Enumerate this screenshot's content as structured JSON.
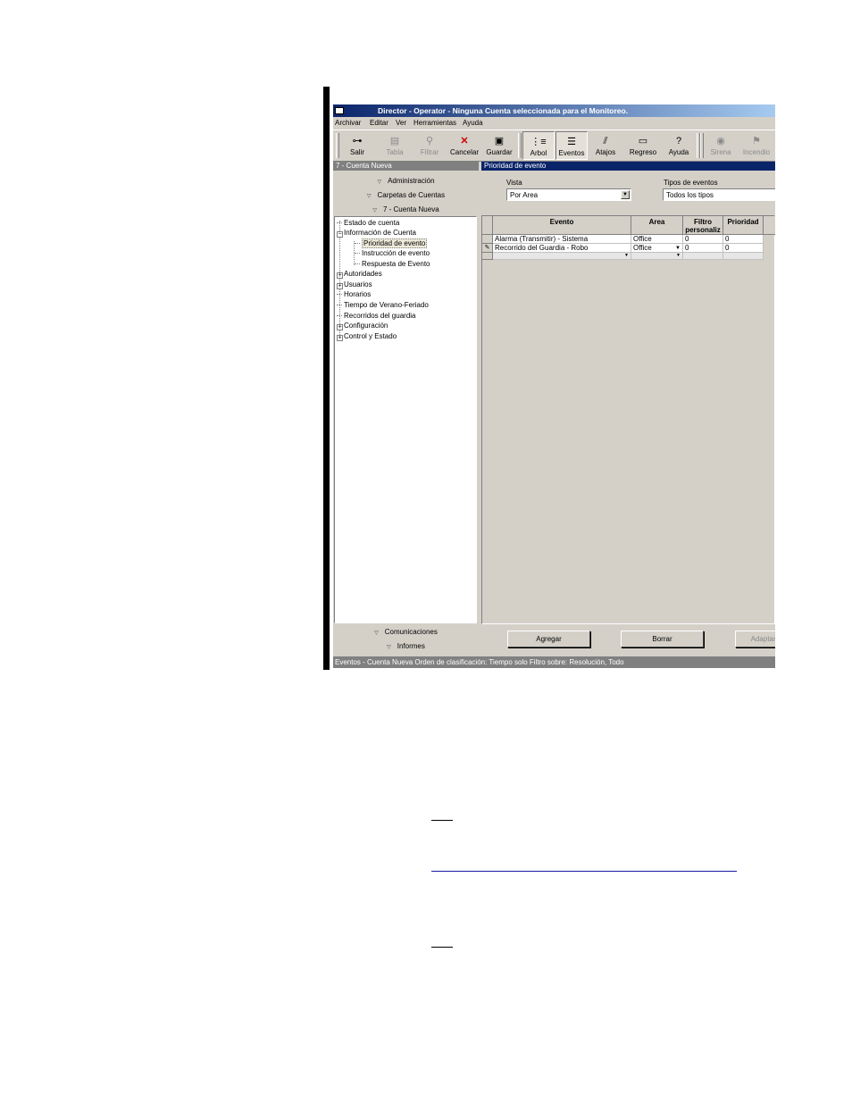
{
  "window": {
    "title": "Director - Operator - Ninguna Cuenta seleccionada para el Monitoreo."
  },
  "menu": [
    "Archivar",
    "Editar",
    "Ver",
    "Herramientas",
    "Ayuda"
  ],
  "toolbar": [
    {
      "label": "Salir",
      "icon": "key-icon",
      "glyph": "⊶",
      "state": "normal"
    },
    {
      "label": "Tabla",
      "icon": "table-icon",
      "glyph": "▤",
      "state": "disabled"
    },
    {
      "label": "Filtrar",
      "icon": "filter-icon",
      "glyph": "⚲",
      "state": "disabled"
    },
    {
      "label": "Cancelar",
      "icon": "cancel-icon",
      "glyph": "✕",
      "state": "normal"
    },
    {
      "label": "Guardar",
      "icon": "save-icon",
      "glyph": "▣",
      "state": "normal"
    },
    {
      "label": "Arbol",
      "icon": "tree-icon",
      "glyph": "⋮≡",
      "state": "pressed"
    },
    {
      "label": "Eventos",
      "icon": "events-icon",
      "glyph": "☰",
      "state": "pressed"
    },
    {
      "label": "Atajos",
      "icon": "shortcuts-icon",
      "glyph": "⫽",
      "state": "normal"
    },
    {
      "label": "Regreso",
      "icon": "return-icon",
      "glyph": "▭",
      "state": "normal"
    },
    {
      "label": "Ayuda",
      "icon": "help-icon",
      "glyph": "?",
      "state": "normal"
    },
    {
      "label": "Sirena",
      "icon": "siren-icon",
      "glyph": "◉",
      "state": "disabled"
    },
    {
      "label": "Incendio",
      "icon": "fire-icon",
      "glyph": "⚑",
      "state": "disabled"
    }
  ],
  "left_panel": {
    "header": "7 - Cuenta Nueva",
    "nav_top": [
      "Administración",
      "Carpetas de Cuentas",
      "7 - Cuenta Nueva"
    ],
    "tree": [
      {
        "label": "Estado de cuenta",
        "level": 0,
        "expander": ""
      },
      {
        "label": "Información de Cuenta",
        "level": 0,
        "expander": "−"
      },
      {
        "label": "Prioridad de evento",
        "level": 1,
        "expander": "",
        "selected": true
      },
      {
        "label": "Instrucción de evento",
        "level": 1,
        "expander": ""
      },
      {
        "label": "Respuesta de Evento",
        "level": 1,
        "expander": ""
      },
      {
        "label": "Autoridades",
        "level": 0,
        "expander": "+"
      },
      {
        "label": "Usuarios",
        "level": 0,
        "expander": "+"
      },
      {
        "label": "Horarios",
        "level": 0,
        "expander": ""
      },
      {
        "label": "Tiempo de Verano-Feriado",
        "level": 0,
        "expander": ""
      },
      {
        "label": "Recorridos del guardia",
        "level": 0,
        "expander": ""
      },
      {
        "label": "Configuración",
        "level": 0,
        "expander": "+"
      },
      {
        "label": "Control y Estado",
        "level": 0,
        "expander": "+"
      }
    ],
    "nav_bottom": [
      "Comunicaciones",
      "Informes"
    ]
  },
  "right_panel": {
    "header": "Prioridad de evento",
    "vista_label": "Vista",
    "vista_value": "Por Area",
    "tipos_label": "Tipos de eventos",
    "tipos_value": "Todos los tipos",
    "columns": [
      "Evento",
      "Area",
      "Filtro personaliz",
      "Prioridad"
    ],
    "rows": [
      {
        "marker": "",
        "evento": "Alarma (Transmitir) - Sistema",
        "area": "Office",
        "filtro": "0",
        "prioridad": "0"
      },
      {
        "marker": "✎",
        "evento": "Recorrido del Guardia - Robo",
        "area": "Office",
        "filtro": "0",
        "prioridad": "0"
      }
    ]
  },
  "buttons": {
    "agregar": "Agregar",
    "borrar": "Borrar",
    "adaptar": "Adaptar p"
  },
  "statusbar": "Eventos - Cuenta Nueva Orden de clasificación: Tiempo solo   Filtro sobre:  Resolución, Todo"
}
